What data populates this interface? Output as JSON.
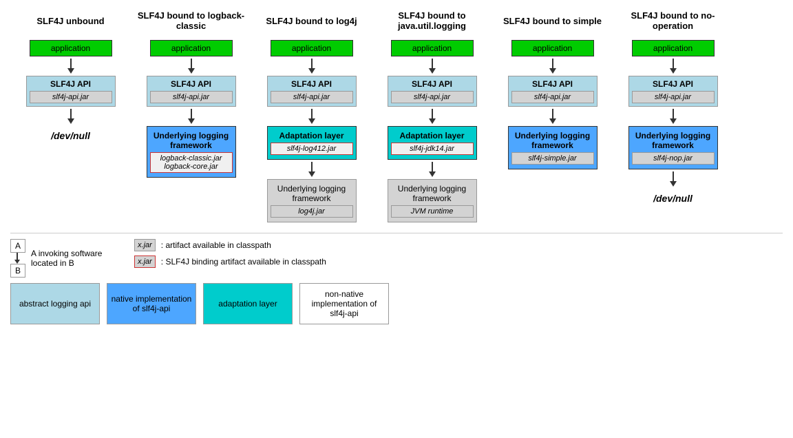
{
  "columns": [
    {
      "id": "unbound",
      "title": "SLF4J unbound",
      "nodes": [
        {
          "type": "green",
          "label": "application"
        },
        {
          "type": "arrow"
        },
        {
          "type": "slf4j-api",
          "title": "SLF4J API",
          "jar": "slf4j-api.jar"
        },
        {
          "type": "arrow"
        },
        {
          "type": "devnull",
          "label": "/dev/null"
        }
      ]
    },
    {
      "id": "logback",
      "title": "SLF4J bound to logback-classic",
      "nodes": [
        {
          "type": "green",
          "label": "application"
        },
        {
          "type": "arrow"
        },
        {
          "type": "slf4j-api",
          "title": "SLF4J API",
          "jar": "slf4j-api.jar"
        },
        {
          "type": "arrow"
        },
        {
          "type": "underlying-blue",
          "title": "Underlying logging framework",
          "jar": "logback-classic.jar\nlogback-core.jar"
        }
      ]
    },
    {
      "id": "log4j",
      "title": "SLF4J bound to log4j",
      "nodes": [
        {
          "type": "green",
          "label": "application"
        },
        {
          "type": "arrow"
        },
        {
          "type": "slf4j-api",
          "title": "SLF4J API",
          "jar": "slf4j-api.jar"
        },
        {
          "type": "arrow"
        },
        {
          "type": "adaptation-cyan",
          "title": "Adaptation layer",
          "jar": "slf4j-log412.jar"
        },
        {
          "type": "arrow"
        },
        {
          "type": "underlying-gray",
          "title": "Underlying logging framework",
          "jar": "log4j.jar"
        }
      ]
    },
    {
      "id": "jul",
      "title": "SLF4J bound to java.util.logging",
      "nodes": [
        {
          "type": "green",
          "label": "application"
        },
        {
          "type": "arrow"
        },
        {
          "type": "slf4j-api",
          "title": "SLF4J API",
          "jar": "slf4j-api.jar"
        },
        {
          "type": "arrow"
        },
        {
          "type": "adaptation-cyan",
          "title": "Adaptation layer",
          "jar": "slf4j-jdk14.jar"
        },
        {
          "type": "arrow"
        },
        {
          "type": "underlying-gray",
          "title": "Underlying logging framework",
          "jar": "JVM runtime"
        }
      ]
    },
    {
      "id": "simple",
      "title": "SLF4J bound to simple",
      "nodes": [
        {
          "type": "green",
          "label": "application"
        },
        {
          "type": "arrow"
        },
        {
          "type": "slf4j-api",
          "title": "SLF4J API",
          "jar": "slf4j-api.jar"
        },
        {
          "type": "arrow"
        },
        {
          "type": "underlying-blue",
          "title": "Underlying logging framework",
          "jar": "slf4j-simple.jar"
        }
      ]
    },
    {
      "id": "nop",
      "title": "SLF4J bound to no-operation",
      "nodes": [
        {
          "type": "green",
          "label": "application"
        },
        {
          "type": "arrow"
        },
        {
          "type": "slf4j-api",
          "title": "SLF4J API",
          "jar": "slf4j-api.jar"
        },
        {
          "type": "arrow"
        },
        {
          "type": "underlying-blue",
          "title": "Underlying logging framework",
          "jar": "slf4j-nop.jar"
        },
        {
          "type": "arrow"
        },
        {
          "type": "devnull",
          "label": "/dev/null"
        }
      ]
    }
  ],
  "legend": {
    "invoke_title": "A invoking software located in B",
    "invoke_a": "A",
    "invoke_b": "B",
    "jar_artifact_label": "x.jar",
    "jar_artifact_desc": ": artifact available in classpath",
    "jar_binding_label": "x.jar",
    "jar_binding_desc": ": SLF4J binding artifact available in classpath"
  },
  "colorLegend": [
    {
      "color": "blue-light",
      "label": "abstract logging api"
    },
    {
      "color": "blue-medium",
      "label": "native implementation of slf4j-api"
    },
    {
      "color": "cyan",
      "label": "adaptation layer"
    },
    {
      "color": "white",
      "label": "non-native implementation of slf4j-api"
    }
  ]
}
